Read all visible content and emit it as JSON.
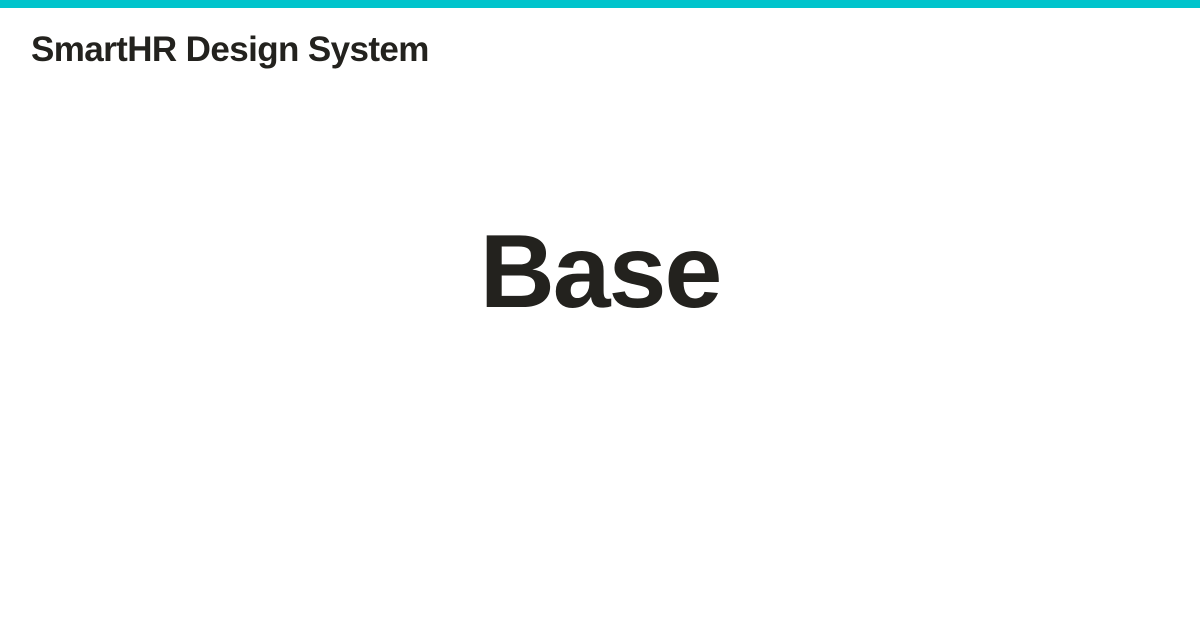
{
  "brand": {
    "title": "SmartHR Design System"
  },
  "page": {
    "title": "Base"
  },
  "colors": {
    "accent_bar": "#00c4cc",
    "text": "#23221e",
    "background": "#ffffff"
  }
}
